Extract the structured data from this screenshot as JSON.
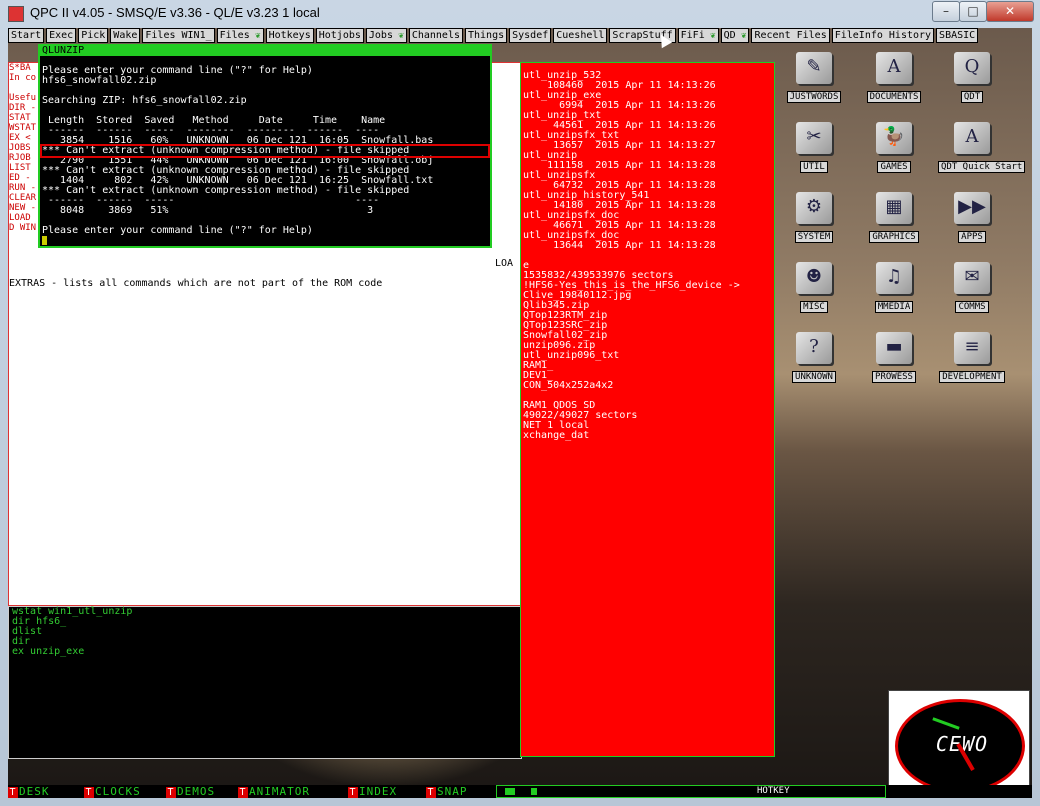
{
  "window": {
    "title": "QPC II v4.05 - SMSQ/E v3.36 - QL/E v3.23 1 local",
    "minimize": "–",
    "maximize": "□",
    "close": "✕"
  },
  "menubar": [
    {
      "label": "Start"
    },
    {
      "label": "Exec"
    },
    {
      "label": "Pick"
    },
    {
      "label": "Wake"
    },
    {
      "label": "Files WIN1_"
    },
    {
      "label": "Files",
      "leaf": true
    },
    {
      "label": "Hotkeys"
    },
    {
      "label": "Hotjobs"
    },
    {
      "label": "Jobs",
      "leaf": true
    },
    {
      "label": "Channels"
    },
    {
      "label": "Things"
    },
    {
      "label": "Sysdef"
    },
    {
      "label": "Cueshell"
    },
    {
      "label": "ScrapStuff"
    },
    {
      "label": "FiFi",
      "leaf": true
    },
    {
      "label": "QD",
      "leaf": true
    },
    {
      "label": "Recent Files"
    },
    {
      "label": "FileInfo History"
    },
    {
      "label": "SBASIC"
    }
  ],
  "main_strip": [
    "S*BA",
    "In co",
    "",
    "Usefu",
    "DIR -",
    "STAT",
    "WSTAT",
    "EX <",
    "JOBS",
    "RJOB",
    "LIST",
    "ED -",
    "RUN -",
    "CLEAR",
    "NEW -",
    "LOAD",
    "D WIN"
  ],
  "extras_line": "EXTRAS - lists all commands which are not part of the ROM code",
  "loa": "LOA",
  "qlunzip": {
    "title": "QLUNZIP",
    "lines": [
      "Please enter your command line (\"?\" for Help)",
      "hfs6_snowfall02.zip",
      "",
      "Searching ZIP: hfs6_snowfall02.zip",
      "",
      " Length  Stored  Saved   Method     Date     Time    Name",
      " ------  ------  -----  --------  --------  ------  ----",
      "   3854    1516   60%   UNKNOWN   06 Dec 121  16:05  Snowfall.bas",
      "*** Can't extract (unknown compression method) - file skipped",
      "   2790    1551   44%   UNKNOWN   06 Dec 121  16:00  Snowfall.obj",
      "*** Can't extract (unknown compression method) - file skipped",
      "   1404     802   42%   UNKNOWN   06 Dec 121  16:25  Snowfall.txt",
      "*** Can't extract (unknown compression method) - file skipped",
      " ------  ------  -----                              ----",
      "   8048    3869   51%                                 3",
      "",
      "Please enter your command line (\"?\" for Help)"
    ]
  },
  "cmd_lines": [
    "wstat win1_utl_unzip",
    "dir hfs6_",
    "dlist",
    "dir",
    "ex unzip_exe"
  ],
  "dir_listing": [
    "utl_unzip_532",
    "    108460  2015 Apr 11 14:13:26",
    "utl_unzip_exe",
    "      6994  2015 Apr 11 14:13:26",
    "utl_unzip_txt",
    "     44561  2015 Apr 11 14:13:26",
    "utl_unzipsfx_txt",
    "     13657  2015 Apr 11 14:13:27",
    "utl_unzip",
    "    111158  2015 Apr 11 14:13:28",
    "utl_unzipsfx",
    "     64732  2015 Apr 11 14:13:28",
    "utl_unzip_history_541",
    "     14180  2015 Apr 11 14:13:28",
    "utl_unzipsfx_doc",
    "     46671  2015 Apr 11 14:13:28",
    "utl_unzipsfx_doc",
    "     13644  2015 Apr 11 14:13:28",
    "",
    "e",
    "1535832/439533976 sectors",
    "!HFS6-Yes_this_is_the_HFS6_device ->",
    "Clive_19840112.jpg",
    "Qlib345.zip",
    "QTop123RTM_zip",
    "QTop123SRC_zip",
    "Snowfall02_zip",
    "unzip096.zip",
    "utl_unzip096_txt",
    "RAM1_",
    "DEV1_",
    "CON_504x252a4x2",
    "",
    "RAM1 QDOS SD",
    "49022/49027 sectors",
    "NET 1 local",
    "xchange_dat"
  ],
  "desktop_icons": [
    {
      "label": "JUSTWORDS",
      "glyph": "✎"
    },
    {
      "label": "DOCUMENTS",
      "glyph": "A"
    },
    {
      "label": "QDT",
      "glyph": "Q"
    },
    {
      "label": "UTIL",
      "glyph": "✂"
    },
    {
      "label": "GAMES",
      "glyph": "🦆"
    },
    {
      "label": "QDT Quick Start",
      "glyph": "A"
    },
    {
      "label": "SYSTEM",
      "glyph": "⚙"
    },
    {
      "label": "GRAPHICS",
      "glyph": "▦"
    },
    {
      "label": "APPS",
      "glyph": "▶▶"
    },
    {
      "label": "MISC",
      "glyph": "☻"
    },
    {
      "label": "MMEDIA",
      "glyph": "♫"
    },
    {
      "label": "COMMS",
      "glyph": "✉"
    },
    {
      "label": "UNKNOWN",
      "glyph": "?"
    },
    {
      "label": "PROWESS",
      "glyph": "▬"
    },
    {
      "label": "DEVELOPMENT",
      "glyph": "≡"
    }
  ],
  "clock": {
    "text": "CEWO"
  },
  "taskbar": [
    {
      "label": "DESK"
    },
    {
      "label": "CLOCKS"
    },
    {
      "label": "DEMOS"
    },
    {
      "label": "ANIMATOR"
    },
    {
      "label": "INDEX"
    },
    {
      "label": "SNAP"
    }
  ],
  "hotkey_label": "HOTKEY"
}
